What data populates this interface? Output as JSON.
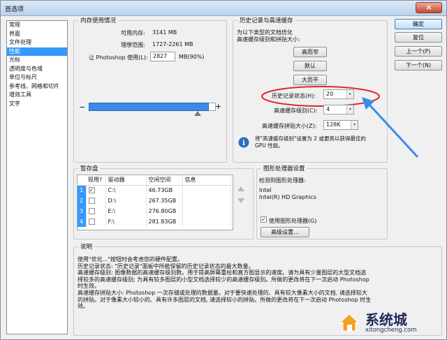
{
  "window": {
    "title": "首选项",
    "close_glyph": "×"
  },
  "sidebar": {
    "items": [
      {
        "label": "常规"
      },
      {
        "label": "界面"
      },
      {
        "label": "文件处理"
      },
      {
        "label": "性能"
      },
      {
        "label": "光标"
      },
      {
        "label": "透明度与色域"
      },
      {
        "label": "单位与标尺"
      },
      {
        "label": "参考线、网格和切片"
      },
      {
        "label": "增效工具"
      },
      {
        "label": "文字"
      }
    ],
    "selected_index": 3
  },
  "memory": {
    "legend": "内存使用情况",
    "available_label": "可用内存:",
    "available_value": "3141 MB",
    "ideal_label": "理想范围:",
    "ideal_value": "1727-2261 MB",
    "use_label": "让 Photoshop 使用(L):",
    "use_value": "2827",
    "use_suffix": "MB(90%)",
    "minus": "−",
    "plus": "+",
    "usage_percent": 90
  },
  "history": {
    "legend": "历史记录与高速缓存",
    "hint": [
      "为以下类型的文档优化",
      "高速缓存级别和拼贴大小:"
    ],
    "btn_tall": "高而窄",
    "btn_default": "默认",
    "btn_large": "大而平",
    "history_states_label": "历史记录状态(H):",
    "history_states_value": "20",
    "cache_levels_label": "高速缓存级别(C):",
    "cache_levels_value": "4",
    "tile_size_label": "高速缓存拼贴大小(Z):",
    "tile_size_value": "128K",
    "info_lines": [
      "将\"高速缓存级别\"设置为 2 或更高以获得最佳的",
      "GPU 性能。"
    ]
  },
  "actions": {
    "ok": "确定",
    "reset": "复位",
    "prev": "上一个(P)",
    "next": "下一个(N)"
  },
  "scratch": {
    "legend": "暂存盘",
    "columns": [
      "现用?",
      "驱动器",
      "空闲空间",
      "信息"
    ],
    "rows": [
      {
        "idx": "1",
        "active": true,
        "drive": "C:\\",
        "free": "46.73GB",
        "info": ""
      },
      {
        "idx": "2",
        "active": false,
        "drive": "D:\\",
        "free": "267.35GB",
        "info": ""
      },
      {
        "idx": "3",
        "active": false,
        "drive": "E:\\",
        "free": "276.80GB",
        "info": ""
      },
      {
        "idx": "4",
        "active": false,
        "drive": "F:\\",
        "free": "281.83GB",
        "info": ""
      }
    ]
  },
  "gpu": {
    "legend": "图形处理器设置",
    "detected_label": "检测到图形处理器:",
    "vendor": "Intel",
    "model": "Intel(R) HD Graphics",
    "use_gpu_label": "使用图形处理器(G)",
    "use_gpu_checked": true,
    "advanced_button": "高级设置..."
  },
  "description": {
    "legend": "说明",
    "lines": [
      "使用\"优化...\"按钮时会考虑您的硬件配置。",
      "历史记录状态: \"历史记录\"面板中所能保留的历史记录状态的最大数量。",
      "高速缓存级别: 图像数据的高速缓存级别数。用于提高屏幕重绘和直方图显示的速度。请为具有少量图层的大型文档选",
      "择较多的高速缓存级别; 为具有较多图层的小型文档选择较少的高速缓存级别。所做的更改将在下一次启动 Photoshop",
      "时生效。",
      "高速缓存拼贴大小: Photoshop 一次存储或处理的数据量。对于要快速处理的、具有较大像素大小的文档, 请选择较大",
      "的拼贴。对于像素大小较小的、具有许多图层的文档, 请选择较小的拼贴。所做的更改将在下一次启动 Photoshop 时生",
      "效。"
    ]
  },
  "watermark": {
    "text": "系统城",
    "url": "xitongcheng.com"
  },
  "colors": {
    "selection": "#3399ff",
    "annotation": "#e0262c",
    "arrow": "#3a8be8"
  }
}
